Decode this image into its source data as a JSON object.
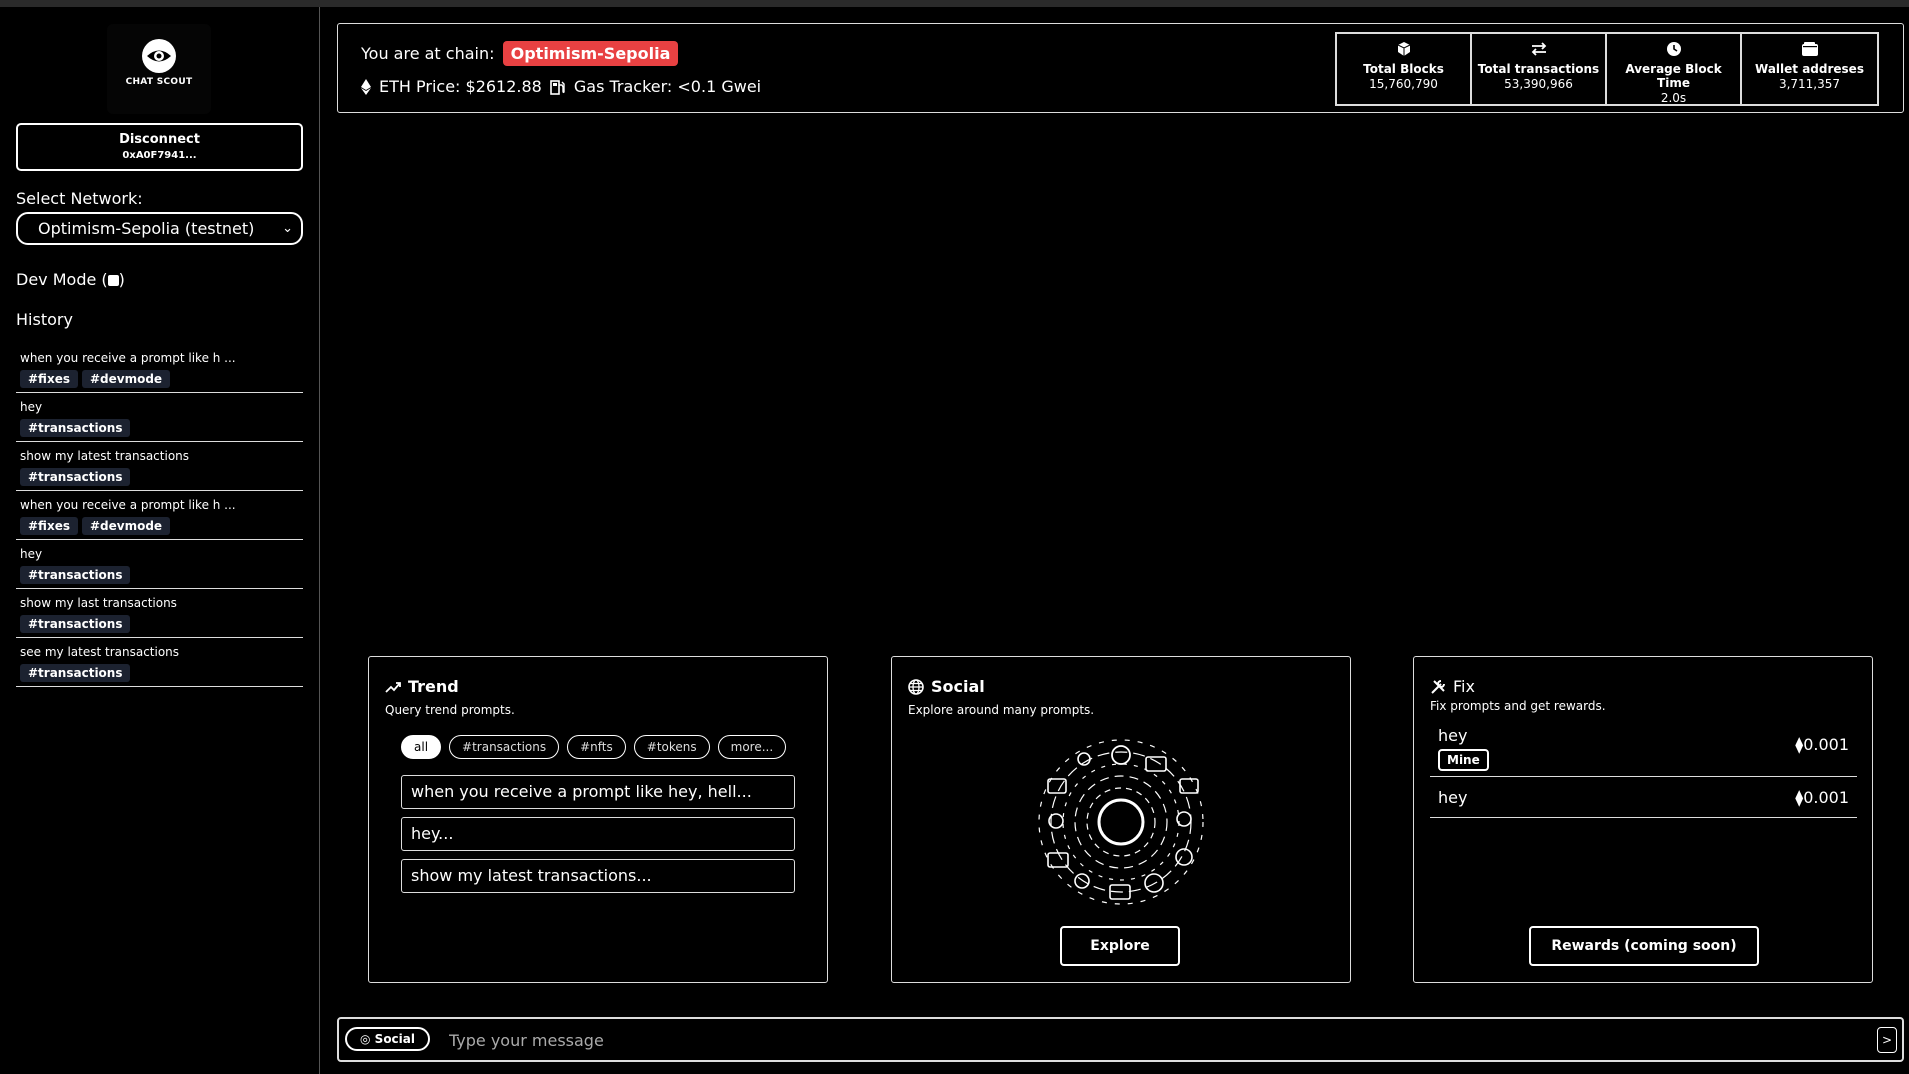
{
  "app": {
    "logo_text": "CHAT SCOUT"
  },
  "sidebar": {
    "disconnect_label": "Disconnect",
    "wallet_address": "0xA0F7941...",
    "network_label": "Select Network:",
    "network_selected": "Optimism-Sepolia (testnet)",
    "dev_mode_label": "Dev Mode (",
    "dev_mode_close": ")",
    "history_title": "History",
    "history": [
      {
        "text": "when you receive a prompt like h ...",
        "tags": [
          "#fixes",
          "#devmode"
        ]
      },
      {
        "text": "hey",
        "tags": [
          "#transactions"
        ]
      },
      {
        "text": "show my latest transactions",
        "tags": [
          "#transactions"
        ]
      },
      {
        "text": "when you receive a prompt like h ...",
        "tags": [
          "#fixes",
          "#devmode"
        ]
      },
      {
        "text": "hey",
        "tags": [
          "#transactions"
        ]
      },
      {
        "text": "show my last transactions",
        "tags": [
          "#transactions"
        ]
      },
      {
        "text": "see my latest transactions",
        "tags": [
          "#transactions"
        ]
      }
    ]
  },
  "header": {
    "chain_prefix": "You are at chain:",
    "chain_name": "Optimism-Sepolia",
    "eth_price": "ETH Price: $2612.88",
    "gas_tracker": "Gas Tracker: <0.1 Gwei",
    "stats": [
      {
        "label": "Total Blocks",
        "value": "15,760,790",
        "icon": "cube-icon"
      },
      {
        "label": "Total transactions",
        "value": "53,390,966",
        "icon": "swap-icon"
      },
      {
        "label": "Average Block Time",
        "value": "2.0s",
        "icon": "clock-icon"
      },
      {
        "label": "Wallet addreses",
        "value": "3,711,357",
        "icon": "wallet-icon"
      }
    ]
  },
  "cards": {
    "trend": {
      "title": "Trend",
      "subtitle": "Query trend prompts.",
      "filters": [
        "all",
        "#transactions",
        "#nfts",
        "#tokens",
        "more..."
      ],
      "prompts": [
        "when you receive a prompt like hey, hell...",
        "hey...",
        "show my latest transactions..."
      ]
    },
    "social": {
      "title": "Social",
      "subtitle": "Explore around many prompts.",
      "button": "Explore"
    },
    "fix": {
      "title": "Fix",
      "subtitle": "Fix prompts and get rewards.",
      "rows": [
        {
          "prompt": "hey",
          "reward": "0.001",
          "badge": "Mine"
        },
        {
          "prompt": "hey",
          "reward": "0.001"
        }
      ],
      "button": "Rewards (coming soon)"
    }
  },
  "message_bar": {
    "mode_label": "Social",
    "placeholder": "Type your message",
    "send_label": ">"
  },
  "colors": {
    "chain_badge": "#e84142",
    "tag_bg": "#1c2230"
  }
}
